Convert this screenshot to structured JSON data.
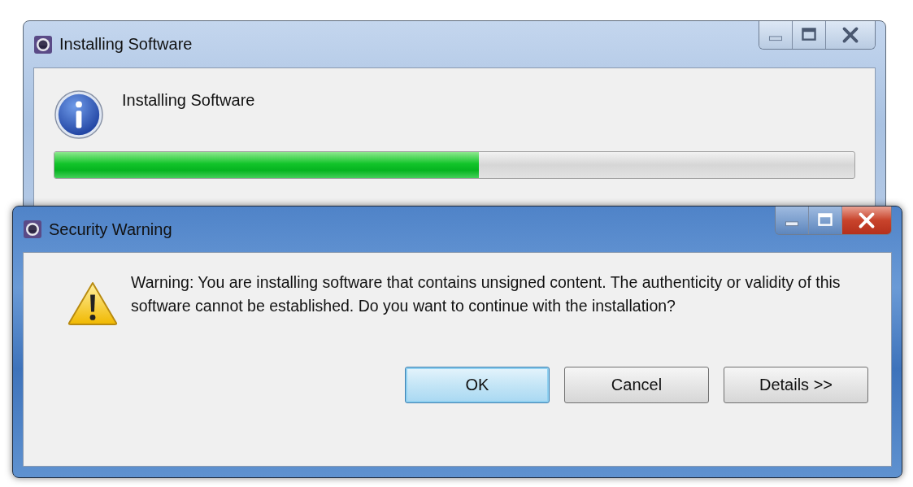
{
  "progress_window": {
    "title": "Installing Software",
    "active": false,
    "heading": "Installing Software",
    "progress": {
      "level": 0.53
    }
  },
  "warning_dialog": {
    "title": "Security Warning",
    "active": true,
    "message": "Warning: You are installing software that contains unsigned content. The authenticity or validity of this software cannot be established. Do you want to continue with the installation?",
    "buttons": [
      {
        "label": "OK",
        "default": true
      },
      {
        "label": "Cancel",
        "default": false
      },
      {
        "label": "Details >>",
        "default": false
      }
    ]
  }
}
